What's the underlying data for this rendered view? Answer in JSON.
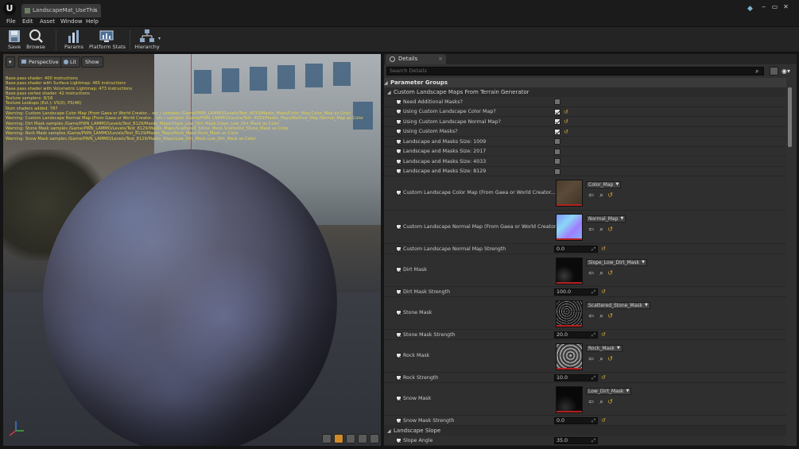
{
  "app": {
    "tab_title": "LandscapeMat_UseThis",
    "tab_close": "×",
    "logo": "U",
    "window_controls": [
      "‒",
      "▭",
      "✕"
    ]
  },
  "menu": [
    "File",
    "Edit",
    "Asset",
    "Window",
    "Help"
  ],
  "toolbar": [
    {
      "label": "Save",
      "icon": "save-icon"
    },
    {
      "label": "Browse",
      "icon": "browse-icon"
    },
    {
      "label": "Params",
      "icon": "params-icon"
    },
    {
      "label": "Platform Stats",
      "icon": "platform-stats-icon"
    },
    {
      "label": "Hierarchy",
      "icon": "hierarchy-icon"
    }
  ],
  "viewport": {
    "menu_label": "▾",
    "perspective": "Perspective",
    "lit": "Lit",
    "show": "Show",
    "stats": [
      "Base pass shader: 400 instructions",
      "Base pass shader with Surface Lightmap: 465 instructions",
      "Base pass shader with Volumetric Lightmap: 473 instructions",
      "Base pass vertex shader: 42 instructions",
      "Texture samplers: 8/16",
      "Texture Lookups (Est.): VS(0), PS(48)",
      "Num shaders added: 787",
      "Warning: Custom Landscape Color Map (From Gaea or World Creator... etc.) samples /Game/PWN_LAMMO/Levels/Test_4033/Masks_Maps/Color_Map.Color_Map as Color",
      "Warning: Custom Landscape Normal Map (From Gaea or World Creator... etc.) samples /Game/PWN_LAMMO/Levels/Test_4033/Masks_Maps/Normal_Map.Normal_Map as Color",
      "Warning: Dirt Mask samples /Game/PWN_LAMMO/Levels/Test_8129/Masks_Maps/Slope_Low_Dirt_Mask.Slope_Low_Dirt_Mask as Color",
      "Warning: Stone Mask samples /Game/PWN_LAMMO/Levels/Test_8129/Masks_Maps/Scattered_Stone_Mask.Scattered_Stone_Mask as Color",
      "Warning: Rock Mask samples /Game/PWN_LAMMO/Levels/Test_8129/Masks_Maps/Rock_Mask.Rock_Mask as Color",
      "Warning: Snow Mask samples /Game/PWN_LAMMO/Levels/Test_8129/Masks_Maps/Low_Dirt_Mask.Low_Dirt_Mask as Color"
    ]
  },
  "details": {
    "tab_label": "Details",
    "search_placeholder": "Search Details",
    "groups_header": "Parameter Groups",
    "category_main": "Custom Landscape Maps From Terrain Generator",
    "category_slope": "Landscape Slope",
    "bool_params": [
      {
        "name": "Need Additional Masks?",
        "checked": false,
        "reset": false
      },
      {
        "name": "Using Custom Landscape Color Map?",
        "checked": true,
        "reset": true
      },
      {
        "name": "Using Custom Landscape Normal Map?",
        "checked": true,
        "reset": true
      },
      {
        "name": "Using Custom Masks?",
        "checked": true,
        "reset": true
      },
      {
        "name": "Landscape and Masks Size: 1009",
        "checked": false,
        "reset": false
      },
      {
        "name": "Landscape and Masks Size: 2017",
        "checked": false,
        "reset": false
      },
      {
        "name": "Landscape and Masks Size: 4033",
        "checked": false,
        "reset": false
      },
      {
        "name": "Landscape and Masks Size: 8129",
        "checked": false,
        "reset": false
      }
    ],
    "texture_params": [
      {
        "name": "Custom Landscape Color Map (From Gaea or World Creator... etc.)",
        "texture": "Color_Map"
      },
      {
        "name": "Custom Landscape Normal Map (From Gaea or World Creator... etc.)",
        "texture": "Normal_Map"
      },
      {
        "name": "Dirt Mask",
        "texture": "Slope_Low_Dirt_Mask"
      },
      {
        "name": "Stone Mask",
        "texture": "Scattered_Stone_Mask"
      },
      {
        "name": "Rock Mask",
        "texture": "Rock_Mask"
      },
      {
        "name": "Snow Mask",
        "texture": "Low_Dirt_Mask"
      }
    ],
    "scalar_params": [
      {
        "name": "Custom Landscape Normal Map Strength",
        "value": "0.0"
      },
      {
        "name": "Dirt Mask Strength",
        "value": "100.0"
      },
      {
        "name": "Stone Mask Strength",
        "value": "20.0"
      },
      {
        "name": "Rock Strength",
        "value": "10.0"
      },
      {
        "name": "Snow Mask Strength",
        "value": "0.0"
      }
    ],
    "slope_param": {
      "name": "Slope Angle",
      "value": "35.0"
    }
  }
}
